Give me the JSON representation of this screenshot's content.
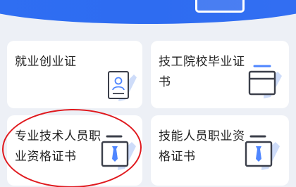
{
  "colors": {
    "brand_blue": "#2f6ef2",
    "card_bg": "#ffffff",
    "page_bg": "#edf0f6",
    "icon_stroke": "#3b3f4a",
    "icon_accent": "#4f86ff",
    "icon_shadow": "#c9d8f8",
    "highlight": "#e0191e"
  },
  "cards": [
    {
      "label_lines": [
        "就业创业证"
      ],
      "icon": "id-card-icon"
    },
    {
      "label_lines": [
        "技工院校毕业证",
        "书"
      ],
      "icon": "certificate-folder-icon"
    },
    {
      "label_lines": [
        "专业技术人员职",
        "业资格证书"
      ],
      "icon": "tie-badge-icon"
    },
    {
      "label_lines": [
        "技能人员职业资",
        "格证书"
      ],
      "icon": "tie-badge-icon"
    }
  ]
}
